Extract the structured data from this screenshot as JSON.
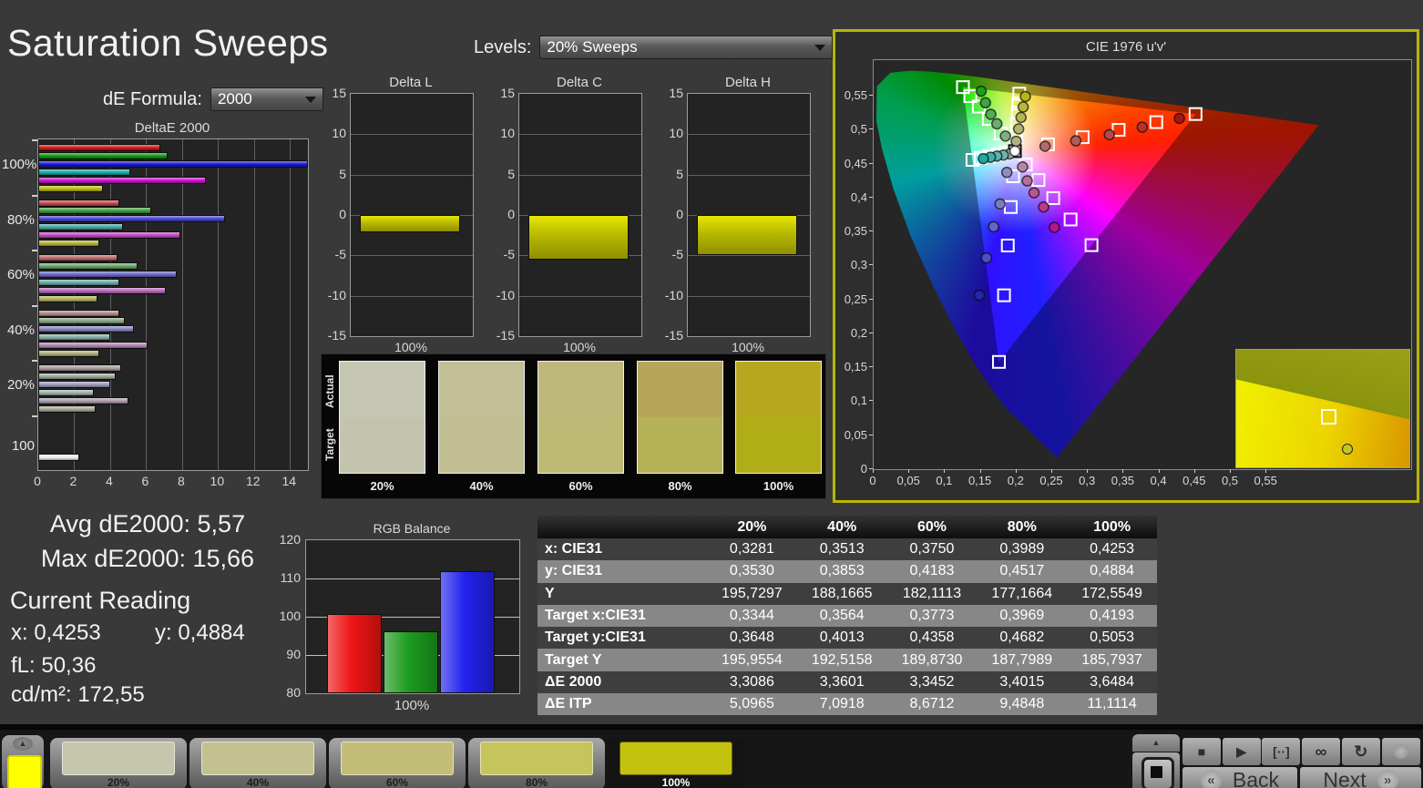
{
  "header": {
    "title": "Saturation Sweeps"
  },
  "controls": {
    "de_formula_label": "dE Formula:",
    "de_formula_value": "2000",
    "levels_label": "Levels:",
    "levels_value": "20% Sweeps"
  },
  "stats": {
    "avg": "Avg dE2000: 5,57",
    "max": "Max dE2000: 15,66",
    "current_reading": "Current Reading",
    "x": "x: 0,4253",
    "y": "y: 0,4884",
    "fl": "fL: 50,36",
    "cdm2": "cd/m²: 172,55"
  },
  "swatch_strip": {
    "actual_label": "Actual",
    "target_label": "Target",
    "patches": [
      {
        "label": "20%",
        "actual": "#c6c7b3",
        "target": "#c4c4ae"
      },
      {
        "label": "40%",
        "actual": "#c2be96",
        "target": "#c1bf92"
      },
      {
        "label": "60%",
        "actual": "#beb87b",
        "target": "#bcba74"
      },
      {
        "label": "80%",
        "actual": "#b7a558",
        "target": "#b5b257"
      },
      {
        "label": "100%",
        "actual": "#b7a71f",
        "target": "#b1ad17"
      }
    ]
  },
  "table": {
    "columns": [
      "20%",
      "40%",
      "60%",
      "80%",
      "100%"
    ],
    "rows": [
      {
        "label": "x: CIE31",
        "values": [
          "0,3281",
          "0,3513",
          "0,3750",
          "0,3989",
          "0,4253"
        ]
      },
      {
        "label": "y: CIE31",
        "values": [
          "0,3530",
          "0,3853",
          "0,4183",
          "0,4517",
          "0,4884"
        ]
      },
      {
        "label": "Y",
        "values": [
          "195,7297",
          "188,1665",
          "182,1113",
          "177,1664",
          "172,5549"
        ]
      },
      {
        "label": "Target x:CIE31",
        "values": [
          "0,3344",
          "0,3564",
          "0,3773",
          "0,3969",
          "0,4193"
        ]
      },
      {
        "label": "Target y:CIE31",
        "values": [
          "0,3648",
          "0,4013",
          "0,4358",
          "0,4682",
          "0,5053"
        ]
      },
      {
        "label": "Target Y",
        "values": [
          "195,9554",
          "192,5158",
          "189,8730",
          "187,7989",
          "185,7937"
        ]
      },
      {
        "label": "ΔE 2000",
        "values": [
          "3,3086",
          "3,3601",
          "3,3452",
          "3,4015",
          "3,6484"
        ]
      },
      {
        "label": "ΔE ITP",
        "values": [
          "5,0965",
          "7,0918",
          "8,6712",
          "9,4848",
          "11,1114"
        ]
      }
    ]
  },
  "chart_data": {
    "delta_e": {
      "type": "bar",
      "title": "DeltaE 2000",
      "x_ticks": [
        0,
        2,
        4,
        6,
        8,
        10,
        12,
        14
      ],
      "xmax": 15,
      "groups": [
        {
          "label": "100%",
          "values": [
            6.8,
            7.2,
            15.0,
            5.1,
            9.3,
            3.6
          ],
          "colors": [
            "#d01818",
            "#109810",
            "#1818d8",
            "#18a8a0",
            "#cc10cc",
            "#bcbc10"
          ]
        },
        {
          "label": "80%",
          "values": [
            4.5,
            6.3,
            10.4,
            4.7,
            7.9,
            3.4
          ],
          "colors": [
            "#c34545",
            "#3f9f3f",
            "#4545cf",
            "#45a8a0",
            "#c345c3",
            "#b5b535"
          ]
        },
        {
          "label": "60%",
          "values": [
            4.4,
            5.5,
            7.7,
            4.5,
            7.1,
            3.3
          ],
          "colors": [
            "#b96868",
            "#68a468",
            "#6868c8",
            "#68aaa2",
            "#ba68ba",
            "#b0b058"
          ]
        },
        {
          "label": "40%",
          "values": [
            4.5,
            4.8,
            5.3,
            4.0,
            6.1,
            3.4
          ],
          "colors": [
            "#b28585",
            "#85a885",
            "#8585c2",
            "#85aca6",
            "#b285b2",
            "#acac7a"
          ]
        },
        {
          "label": "20%",
          "values": [
            4.6,
            4.3,
            4.0,
            3.1,
            5.0,
            3.2
          ],
          "colors": [
            "#ab9b9b",
            "#9bab9b",
            "#9b9bbd",
            "#9bb0ac",
            "#ab9bab",
            "#a8a895"
          ]
        },
        {
          "label": "100",
          "values": [
            2.3
          ],
          "colors": [
            "#ececec"
          ]
        }
      ]
    },
    "delta_lch": {
      "type": "bar",
      "yticks": [
        15,
        10,
        5,
        0,
        -5,
        -10,
        -15
      ],
      "ymin": -15,
      "ymax": 15,
      "xlabel": "100%",
      "bar_color": "#c6c600",
      "charts": [
        {
          "title": "Delta L",
          "value": -2.1
        },
        {
          "title": "Delta C",
          "value": -5.5
        },
        {
          "title": "Delta H",
          "value": -5.0
        }
      ]
    },
    "rgb_balance": {
      "type": "bar",
      "title": "RGB Balance",
      "categories": [
        "Red",
        "Green",
        "Blue"
      ],
      "values": [
        100.7,
        96.2,
        111.9
      ],
      "colors": [
        "#ee1414",
        "#1d9b1d",
        "#2222ee"
      ],
      "yticks": [
        120,
        110,
        100,
        90,
        80
      ],
      "ymin": 80,
      "ymax": 120,
      "xlabel": "100%"
    },
    "cie": {
      "type": "scatter",
      "title": "CIE 1976 u'v'",
      "x_ticks": [
        "0",
        "0,05",
        "0,1",
        "0,15",
        "0,2",
        "0,25",
        "0,3",
        "0,35",
        "0,4",
        "0,45",
        "0,5",
        "0,55"
      ],
      "y_ticks": [
        "0",
        "0,05",
        "0,1",
        "0,15",
        "0,2",
        "0,25",
        "0,3",
        "0,35",
        "0,4",
        "0,45",
        "0,5",
        "0,55"
      ],
      "white_point": {
        "u": 0.1978,
        "v": 0.4683
      },
      "sweeps": [
        {
          "name": "red",
          "targets": [
            [
              0.2442,
              0.4783
            ],
            [
              0.2926,
              0.4888
            ],
            [
              0.343,
              0.4996
            ],
            [
              0.3957,
              0.511
            ],
            [
              0.4507,
              0.5229
            ]
          ],
          "measured": [
            [
              0.24,
              0.4755
            ],
            [
              0.283,
              0.4835
            ],
            [
              0.33,
              0.4925
            ],
            [
              0.376,
              0.5035
            ],
            [
              0.428,
              0.5165
            ]
          ],
          "colors": [
            "#b36a6a",
            "#b55a5a",
            "#b84747",
            "#bb3030",
            "#a51515"
          ]
        },
        {
          "name": "green",
          "targets": [
            [
              0.1778,
              0.4942
            ],
            [
              0.1612,
              0.5157
            ],
            [
              0.1472,
              0.5338
            ],
            [
              0.1353,
              0.5492
            ],
            [
              0.125,
              0.5625
            ]
          ],
          "measured": [
            [
              0.1845,
              0.4905
            ],
            [
              0.1725,
              0.5085
            ],
            [
              0.164,
              0.5225
            ],
            [
              0.1565,
              0.5395
            ],
            [
              0.1505,
              0.5565
            ]
          ],
          "colors": [
            "#7fae7f",
            "#6cae6c",
            "#55ab55",
            "#3da63d",
            "#1c9e1c"
          ]
        },
        {
          "name": "blue",
          "targets": [
            [
              0.1952,
              0.4313
            ],
            [
              0.1919,
              0.386
            ],
            [
              0.1878,
              0.3293
            ],
            [
              0.1825,
              0.256
            ],
            [
              0.1754,
              0.1579
            ]
          ],
          "measured": [
            [
              0.1865,
              0.437
            ],
            [
              0.177,
              0.3905
            ],
            [
              0.168,
              0.357
            ],
            [
              0.158,
              0.311
            ],
            [
              0.148,
              0.256
            ]
          ],
          "colors": [
            "#8d8dc0",
            "#7c7cc4",
            "#6666c8",
            "#4d4dcc",
            "#2626b0"
          ]
        },
        {
          "name": "cyan",
          "targets": [
            [
              0.1857,
              0.4657
            ],
            [
              0.1736,
              0.4631
            ],
            [
              0.1617,
              0.4605
            ],
            [
              0.15,
              0.458
            ],
            [
              0.1383,
              0.4554
            ]
          ],
          "measured": [
            [
              0.1905,
              0.4642
            ],
            [
              0.1815,
              0.4625
            ],
            [
              0.1725,
              0.461
            ],
            [
              0.1635,
              0.4592
            ],
            [
              0.1535,
              0.4572
            ]
          ],
          "colors": [
            "#8cb3ab",
            "#74b3ab",
            "#5bb3ab",
            "#41b0a8",
            "#1caca4"
          ]
        },
        {
          "name": "magenta",
          "targets": [
            [
              0.2131,
              0.4486
            ],
            [
              0.2308,
              0.4257
            ],
            [
              0.2514,
              0.3991
            ],
            [
              0.2757,
              0.3676
            ],
            [
              0.305,
              0.3298
            ]
          ],
          "measured": [
            [
              0.2085,
              0.445
            ],
            [
              0.215,
              0.4245
            ],
            [
              0.2245,
              0.407
            ],
            [
              0.238,
              0.386
            ],
            [
              0.253,
              0.356
            ]
          ],
          "colors": [
            "#b388ab",
            "#b56e9f",
            "#b85594",
            "#bb3a8a",
            "#b5158f"
          ]
        },
        {
          "name": "yellow",
          "targets": [
            [
              0.1994,
              0.4894
            ],
            [
              0.2007,
              0.5085
            ],
            [
              0.2019,
              0.5247
            ],
            [
              0.2029,
              0.5385
            ],
            [
              0.2039,
              0.5529
            ]
          ],
          "measured": [
            [
              0.1995,
              0.4828
            ],
            [
              0.203,
              0.501
            ],
            [
              0.2063,
              0.5179
            ],
            [
              0.2093,
              0.5333
            ],
            [
              0.2124,
              0.5487
            ]
          ],
          "colors": [
            "#b0b084",
            "#b2b26c",
            "#b5b554",
            "#b8b83a",
            "#b5b513"
          ]
        }
      ],
      "inset": {
        "square": [
          0.49,
          0.5
        ],
        "circle": [
          0.61,
          0.8
        ],
        "circle_color": "#c6c620"
      }
    }
  },
  "bottom_bar": {
    "up_arrow": "▲",
    "pattern_color": "#ffff00",
    "tiles": [
      {
        "label": "20%",
        "color": "#c6c6ad",
        "selected": false
      },
      {
        "label": "40%",
        "color": "#c4c191",
        "selected": false
      },
      {
        "label": "60%",
        "color": "#c2be77",
        "selected": false
      },
      {
        "label": "80%",
        "color": "#c6c45c",
        "selected": false
      },
      {
        "label": "100%",
        "color": "#c2c20e",
        "selected": true
      }
    ],
    "transport": [
      {
        "name": "stop",
        "glyph": "■"
      },
      {
        "name": "play",
        "glyph": "▶"
      },
      {
        "name": "loop-range",
        "glyph": "[··]"
      },
      {
        "name": "infinity",
        "glyph": "∞"
      },
      {
        "name": "refresh",
        "glyph": "↻"
      },
      {
        "name": "blank",
        "glyph": ""
      }
    ],
    "back_arrow": "«",
    "back_label": "Back",
    "next_label": "Next",
    "next_arrow": "»"
  }
}
